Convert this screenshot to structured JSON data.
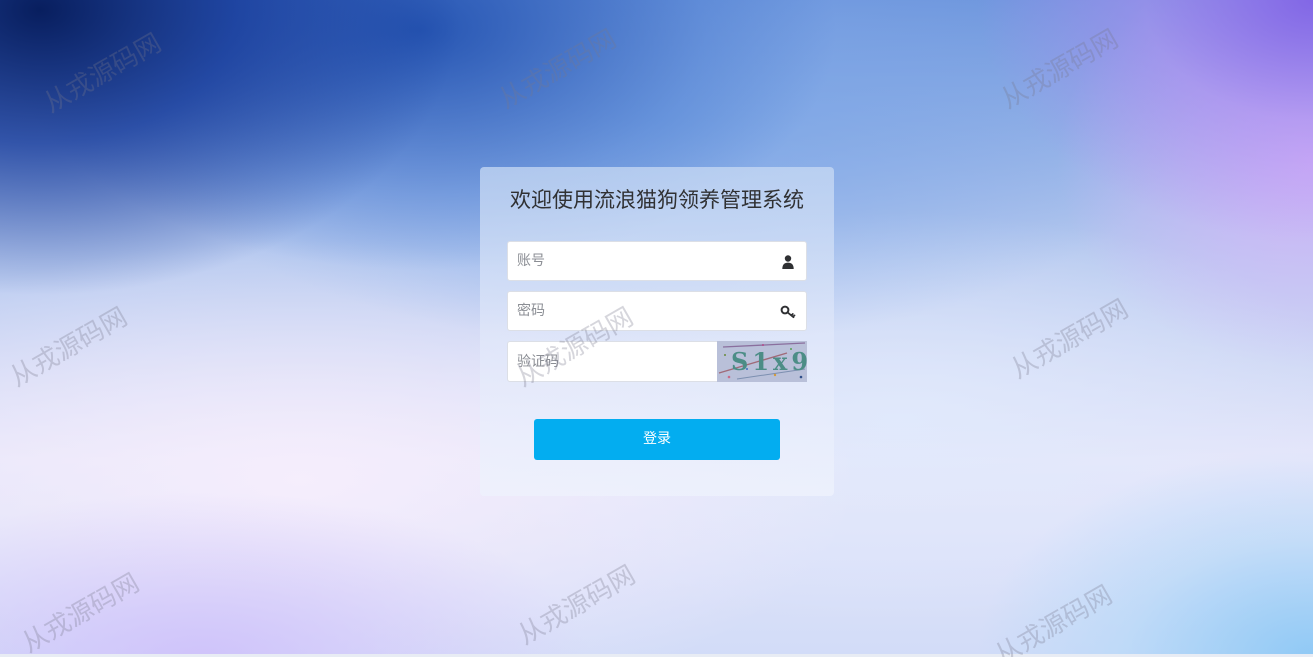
{
  "page": {
    "title": "欢迎使用流浪猫狗领养管理系统"
  },
  "form": {
    "username_placeholder": "账号",
    "password_placeholder": "密码",
    "captcha_placeholder": "验证码",
    "captcha_text": "S1x9",
    "login_label": "登录"
  },
  "icons": {
    "username": "user-icon",
    "password": "key-icon"
  },
  "watermark": {
    "text": "从戎源码网"
  },
  "colors": {
    "primary_button": "#03adf0",
    "title_text": "#303133"
  }
}
